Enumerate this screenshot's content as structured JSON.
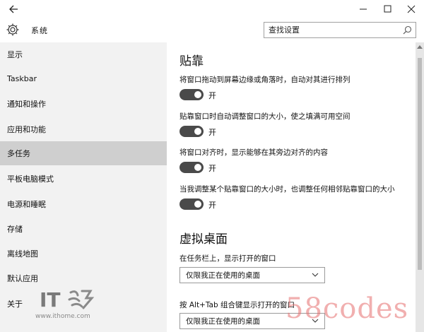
{
  "window": {
    "title": "系统"
  },
  "search": {
    "placeholder": "查找设置"
  },
  "sidebar": {
    "items": [
      {
        "label": "显示"
      },
      {
        "label": "Taskbar"
      },
      {
        "label": "通知和操作"
      },
      {
        "label": "应用和功能"
      },
      {
        "label": "多任务",
        "active": true
      },
      {
        "label": "平板电脑模式"
      },
      {
        "label": "电源和睡眠"
      },
      {
        "label": "存储"
      },
      {
        "label": "离线地图"
      },
      {
        "label": "默认应用"
      },
      {
        "label": "关于"
      }
    ]
  },
  "snap": {
    "title": "贴靠",
    "options": [
      {
        "text": "将窗口拖动到屏幕边缘或角落时，自动对其进行排列",
        "state": "开"
      },
      {
        "text": "贴靠窗口时自动调整窗口的大小，使之填满可用空间",
        "state": "开"
      },
      {
        "text": "将窗口对齐时，显示能够在其旁边对齐的内容",
        "state": "开"
      },
      {
        "text": "当我调整某个贴靠窗口的大小时，也调整任何相邻贴靠窗口的大小",
        "state": "开"
      }
    ]
  },
  "virtual_desktops": {
    "title": "虚拟桌面",
    "taskbar_label": "在任务栏上，显示打开的窗口",
    "taskbar_value": "仅限我正在使用的桌面",
    "alttab_label": "按 Alt+Tab 组合键显示打开的窗口",
    "alttab_value": "仅限我正在使用的桌面"
  },
  "watermarks": {
    "logo_text": "IT",
    "url": "www.ithome.com",
    "site": "58codes"
  },
  "colors": {
    "toggle_on": "#4a4a4a",
    "sidebar_bg": "#f2f2f2",
    "active_item": "#cfcfcf"
  }
}
